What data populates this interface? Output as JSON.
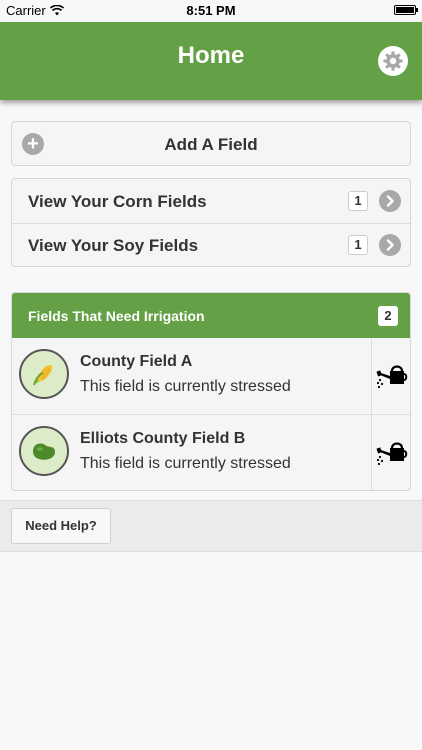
{
  "status_bar": {
    "carrier": "Carrier",
    "time": "8:51 PM"
  },
  "header": {
    "title": "Home"
  },
  "add_field": {
    "label": "Add A Field"
  },
  "views": [
    {
      "label": "View Your Corn Fields",
      "count": "1"
    },
    {
      "label": "View Your Soy Fields",
      "count": "1"
    }
  ],
  "irrigation": {
    "title": "Fields That Need Irrigation",
    "count": "2",
    "fields": [
      {
        "name": "County Field A",
        "status": "This field is currently stressed",
        "crop_icon": "corn-icon"
      },
      {
        "name": "Elliots County Field B",
        "status": "This field is currently stressed",
        "crop_icon": "soybean-icon"
      }
    ]
  },
  "help": {
    "label": "Need Help?"
  },
  "colors": {
    "brand_green": "#64a045",
    "avatar_bg": "#dcecc8"
  }
}
